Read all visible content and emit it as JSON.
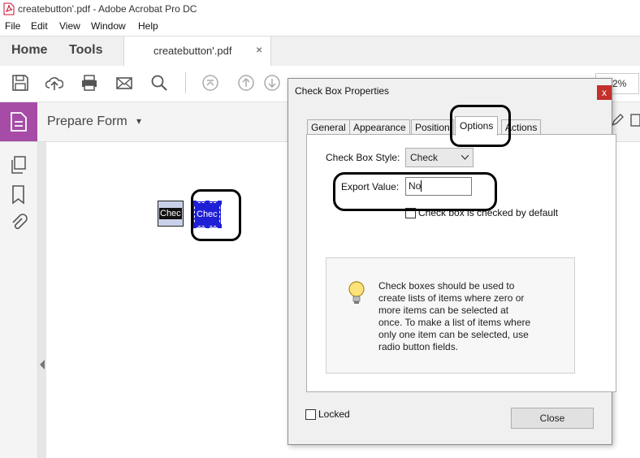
{
  "window": {
    "title": "createbutton'.pdf - Adobe Acrobat Pro DC"
  },
  "menu": [
    "File",
    "Edit",
    "View",
    "Window",
    "Help"
  ],
  "nav_tabs": {
    "home": "Home",
    "tools": "Tools",
    "doc_tab": "createbutton'.pdf",
    "doc_close": "×"
  },
  "toolbar": {
    "zoom": "2%"
  },
  "prepare_form": {
    "label": "Prepare Form",
    "caret": "▾"
  },
  "document": {
    "field1": "Chec",
    "field2": "Chec"
  },
  "dialog": {
    "title": "Check Box Properties",
    "close_glyph": "x",
    "tabs": [
      "General",
      "Appearance",
      "Position",
      "Options",
      "Actions"
    ],
    "active_tab": "Options",
    "checkbox_style_label": "Check Box Style:",
    "checkbox_style_value": "Check",
    "export_value_label": "Export Value:",
    "export_value": "No",
    "checked_default_label": "Check box is checked by default",
    "info_text": [
      "Check boxes should be used to",
      "create lists of items where zero or",
      "more items can be selected at",
      "once. To make a list of items where",
      "only one item can be selected, use",
      "radio button fields."
    ],
    "locked_label": "Locked",
    "close_button": "Close"
  },
  "colors": {
    "accent_purple": "#a64ca6",
    "dialog_close_red": "#c4302b",
    "selected_field_blue": "#1f1fd6"
  }
}
